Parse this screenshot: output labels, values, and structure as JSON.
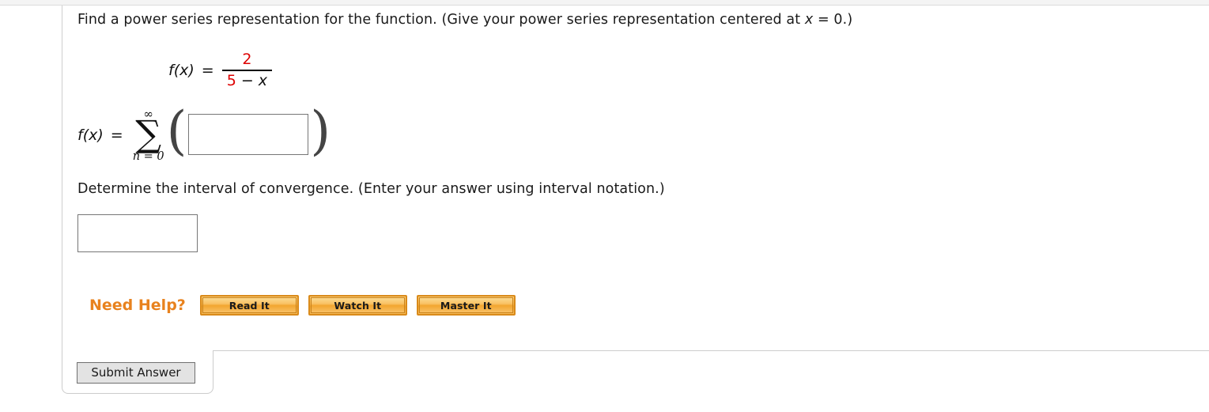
{
  "question": {
    "prompt_1_before_var": "Find a power series representation for the function. (Give your power series representation centered at ",
    "prompt_1_var": "x",
    "prompt_1_after_var": " = 0.)",
    "prompt_2": "Determine the interval of convergence. (Enter your answer using interval notation.)"
  },
  "function_display": {
    "lhs": "f(x)",
    "equals": "=",
    "numerator": "2",
    "denominator_first": "5",
    "denominator_operator": "−",
    "denominator_variable": "x",
    "numerator_color": "#dd0000",
    "denominator_color": "#dd0000"
  },
  "series_display": {
    "lhs": "f(x)",
    "equals": "=",
    "sigma": "∑",
    "upper_limit": "∞",
    "lower_limit": "n = 0",
    "paren_left": "(",
    "paren_right": ")",
    "input_value": "",
    "input_placeholder": ""
  },
  "interval_answer": {
    "input_value": "",
    "input_placeholder": ""
  },
  "need_help": {
    "label": "Need Help?",
    "buttons": [
      {
        "label": "Read It"
      },
      {
        "label": "Watch It"
      },
      {
        "label": "Master It"
      }
    ]
  },
  "submit": {
    "label": "Submit Answer"
  },
  "theme": {
    "accent_orange": "#E8821E",
    "math_red": "#dd0000",
    "text_black": "#1a1a1a",
    "rule_gray": "#cccccc"
  }
}
